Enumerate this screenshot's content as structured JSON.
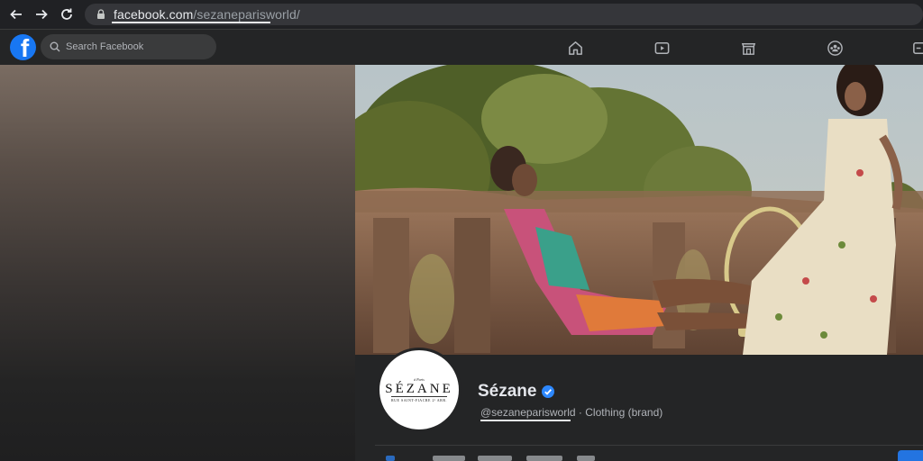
{
  "browser": {
    "url_host": "facebook.com",
    "url_path": "/sezaneparisworld/"
  },
  "facebook": {
    "search_placeholder": "Search Facebook",
    "nav_icons": [
      "home-icon",
      "watch-icon",
      "marketplace-icon",
      "groups-icon",
      "gaming-icon"
    ]
  },
  "page": {
    "avatar": {
      "top_text": "à Paris",
      "brand": "SÉZANE",
      "bottom_text": "RUE SAINT-FIACRE 2ᵉ ARR."
    },
    "name": "Sézane",
    "handle": "@sezaneparisworld",
    "separator": " · ",
    "category": "Clothing (brand)"
  },
  "colors": {
    "fb_blue": "#1877f2",
    "header_bg": "#242526",
    "page_bg": "#18191a"
  }
}
